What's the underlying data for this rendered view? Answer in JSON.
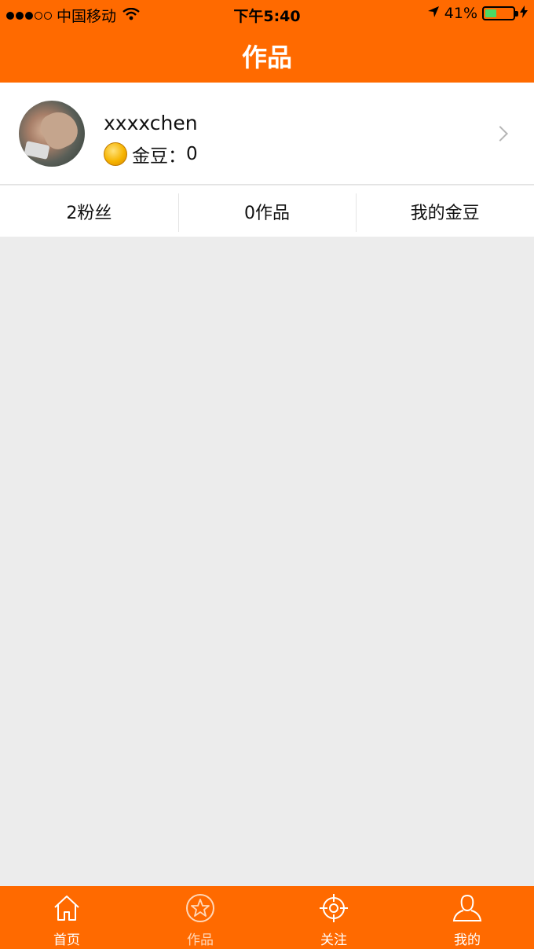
{
  "status_bar": {
    "carrier": "中国移动",
    "time": "下午5:40",
    "battery": "41%"
  },
  "header": {
    "title": "作品"
  },
  "profile": {
    "username": "xxxxchen",
    "coin_label": "金豆：",
    "coin_value": "0"
  },
  "stats": {
    "fans": "2粉丝",
    "works": "0作品",
    "my_coins": "我的金豆"
  },
  "tabbar": {
    "items": [
      {
        "label": "首页",
        "icon": "home-icon"
      },
      {
        "label": "作品",
        "icon": "star-icon"
      },
      {
        "label": "关注",
        "icon": "target-icon"
      },
      {
        "label": "我的",
        "icon": "user-icon"
      }
    ],
    "active_index": 1
  },
  "colors": {
    "brand": "#ff6a00",
    "background": "#ececec"
  }
}
